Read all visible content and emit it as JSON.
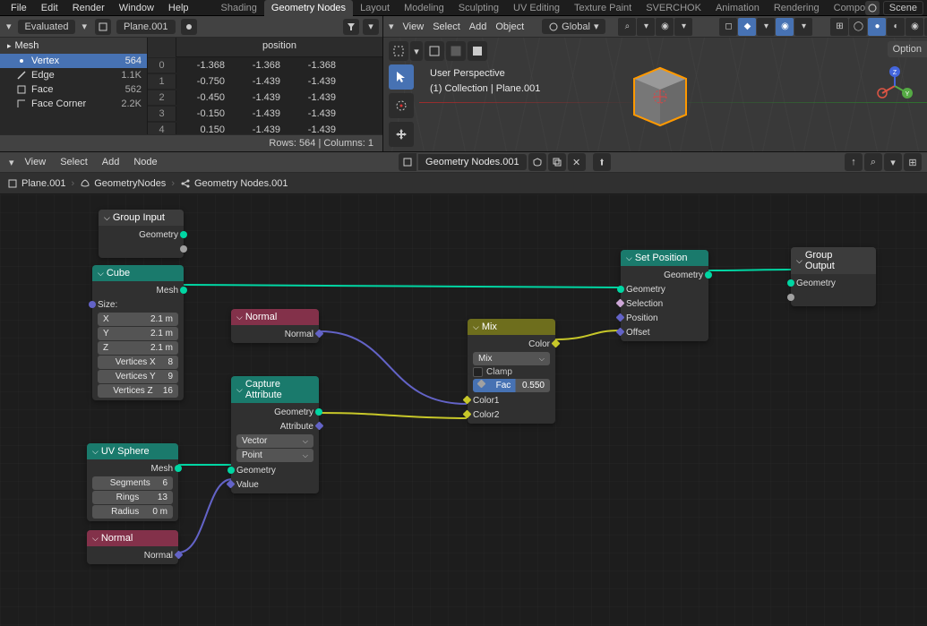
{
  "top_menu": {
    "items": [
      "File",
      "Edit",
      "Render",
      "Window",
      "Help"
    ]
  },
  "workspaces": {
    "items": [
      "Shading",
      "Geometry Nodes",
      "Layout",
      "Modeling",
      "Sculpting",
      "UV Editing",
      "Texture Paint",
      "SVERCHOK",
      "Animation",
      "Rendering",
      "Compositi"
    ],
    "active": 1
  },
  "scene_field": {
    "label": "Scene"
  },
  "spreadsheet": {
    "mode": "Evaluated",
    "object": "Plane.001",
    "domain_group": "Mesh",
    "domains": [
      {
        "label": "Vertex",
        "count": "564",
        "active": true
      },
      {
        "label": "Edge",
        "count": "1.1K"
      },
      {
        "label": "Face",
        "count": "562"
      },
      {
        "label": "Face Corner",
        "count": "2.2K"
      }
    ],
    "column": "position",
    "rows": [
      {
        "i": 0,
        "x": "-1.368",
        "y": "-1.368",
        "z": "-1.368"
      },
      {
        "i": 1,
        "x": "-0.750",
        "y": "-1.439",
        "z": "-1.439"
      },
      {
        "i": 2,
        "x": "-0.450",
        "y": "-1.439",
        "z": "-1.439"
      },
      {
        "i": 3,
        "x": "-0.150",
        "y": "-1.439",
        "z": "-1.439"
      },
      {
        "i": 4,
        "x": "0.150",
        "y": "-1.439",
        "z": "-1.439"
      }
    ],
    "footer": "Rows: 564   |   Columns: 1"
  },
  "viewport": {
    "menus": [
      "View",
      "Select",
      "Add",
      "Object"
    ],
    "orientation": "Global",
    "info_line1": "User Perspective",
    "info_line2": "(1) Collection | Plane.001",
    "options_tab": "Option"
  },
  "node_header": {
    "menus": [
      "View",
      "Select",
      "Add",
      "Node"
    ],
    "nodegroup": "Geometry Nodes.001"
  },
  "breadcrumb": {
    "obj": "Plane.001",
    "mod": "GeometryNodes",
    "ng": "Geometry Nodes.001"
  },
  "nodes": {
    "group_input": {
      "title": "Group Input",
      "out1": "Geometry"
    },
    "cube": {
      "title": "Cube",
      "out1": "Mesh",
      "size_label": "Size:",
      "size": {
        "x_lbl": "X",
        "x": "2.1 m",
        "y_lbl": "Y",
        "y": "2.1 m",
        "z_lbl": "Z",
        "z": "2.1 m"
      },
      "vx_lbl": "Vertices X",
      "vx": "8",
      "vy_lbl": "Vertices Y",
      "vy": "9",
      "vz_lbl": "Vertices Z",
      "vz": "16"
    },
    "normal1": {
      "title": "Normal",
      "out1": "Normal"
    },
    "capture": {
      "title": "Capture Attribute",
      "out1": "Geometry",
      "out2": "Attribute",
      "type": "Vector",
      "domain": "Point",
      "in1": "Geometry",
      "in2": "Value"
    },
    "mix": {
      "title": "Mix",
      "out1": "Color",
      "blend": "Mix",
      "clamp": "Clamp",
      "fac_lbl": "Fac",
      "fac": "0.550",
      "c1": "Color1",
      "c2": "Color2"
    },
    "setpos": {
      "title": "Set Position",
      "out1": "Geometry",
      "in1": "Geometry",
      "in2": "Selection",
      "in3": "Position",
      "in4": "Offset"
    },
    "group_output": {
      "title": "Group Output",
      "in1": "Geometry"
    },
    "uvsphere": {
      "title": "UV Sphere",
      "out1": "Mesh",
      "seg_lbl": "Segments",
      "seg": "6",
      "ring_lbl": "Rings",
      "ring": "13",
      "rad_lbl": "Radius",
      "rad": "0 m"
    },
    "normal2": {
      "title": "Normal",
      "out1": "Normal"
    }
  }
}
